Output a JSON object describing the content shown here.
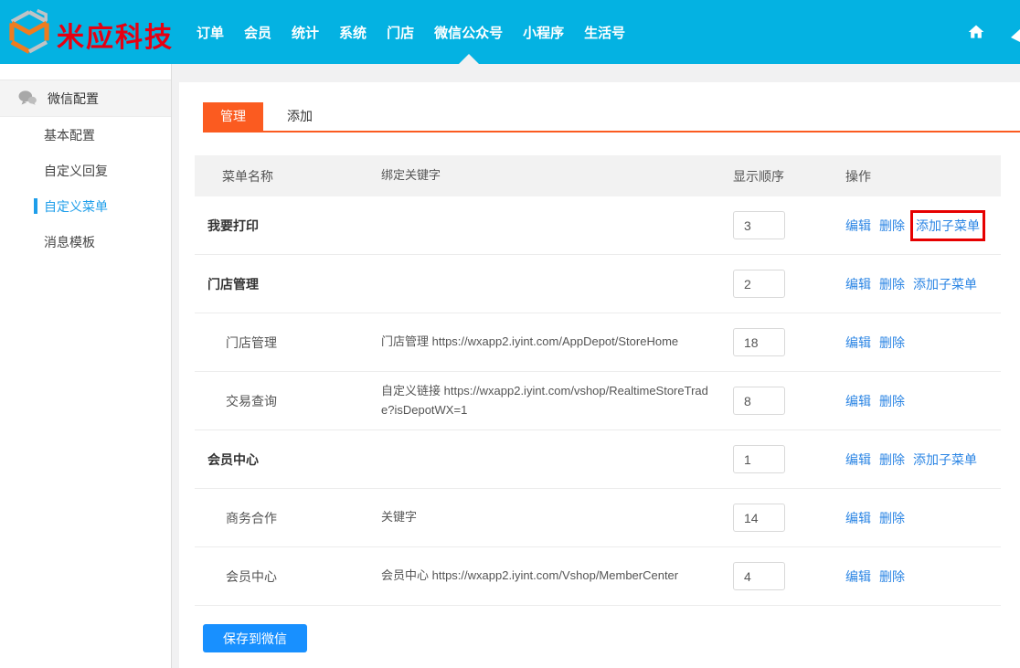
{
  "header": {
    "brand": "米应科技",
    "nav": [
      "订单",
      "会员",
      "统计",
      "系统",
      "门店",
      "微信公众号",
      "小程序",
      "生活号"
    ],
    "active_nav": "微信公众号"
  },
  "sidebar": {
    "section_label": "微信配置",
    "items": [
      {
        "label": "基本配置",
        "active": false
      },
      {
        "label": "自定义回复",
        "active": false
      },
      {
        "label": "自定义菜单",
        "active": true
      },
      {
        "label": "消息模板",
        "active": false
      }
    ]
  },
  "tabs": [
    {
      "label": "管理",
      "active": true
    },
    {
      "label": "添加",
      "active": false
    }
  ],
  "table": {
    "headers": [
      "菜单名称",
      "绑定关键字",
      "显示顺序",
      "操作"
    ],
    "rows": [
      {
        "name": "我要打印",
        "level": 1,
        "keyword": "",
        "order": "3",
        "actions": [
          "编辑",
          "删除",
          "添加子菜单"
        ],
        "highlighted_action": "添加子菜单"
      },
      {
        "name": "门店管理",
        "level": 1,
        "keyword": "",
        "order": "2",
        "actions": [
          "编辑",
          "删除",
          "添加子菜单"
        ]
      },
      {
        "name": "门店管理",
        "level": 2,
        "keyword": "门店管理 https://wxapp2.iyint.com/AppDepot/StoreHome",
        "order": "18",
        "actions": [
          "编辑",
          "删除"
        ]
      },
      {
        "name": "交易查询",
        "level": 2,
        "keyword": "自定义链接 https://wxapp2.iyint.com/vshop/RealtimeStoreTrade?isDepotWX=1",
        "order": "8",
        "actions": [
          "编辑",
          "删除"
        ]
      },
      {
        "name": "会员中心",
        "level": 1,
        "keyword": "",
        "order": "1",
        "actions": [
          "编辑",
          "删除",
          "添加子菜单"
        ]
      },
      {
        "name": "商务合作",
        "level": 2,
        "keyword": "关键字",
        "order": "14",
        "actions": [
          "编辑",
          "删除"
        ]
      },
      {
        "name": "会员中心",
        "level": 2,
        "keyword": "会员中心 https://wxapp2.iyint.com/Vshop/MemberCenter",
        "order": "4",
        "actions": [
          "编辑",
          "删除"
        ]
      }
    ]
  },
  "save_button_label": "保存到微信",
  "colors": {
    "header_bg": "#04b2e2",
    "brand_red": "#e60012",
    "logo_orange": "#ee7c1f",
    "tab_accent": "#fb5b20",
    "link_blue": "#2b85e4",
    "sidebar_active": "#1e9eea",
    "save_button": "#1890ff",
    "annotation_red": "#e60000"
  }
}
